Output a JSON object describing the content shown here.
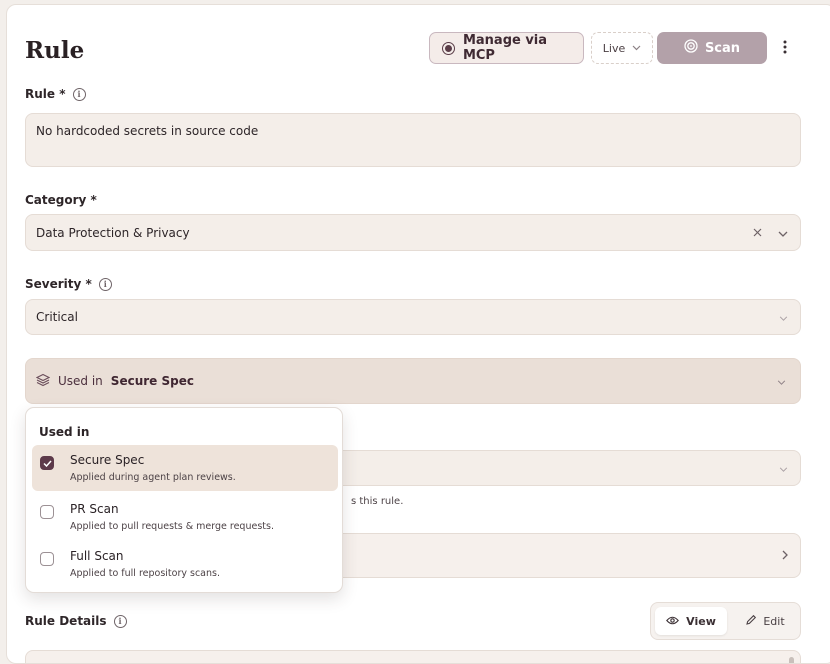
{
  "header": {
    "title": "Rule",
    "mcp_label": "Manage via MCP",
    "live_label": "Live",
    "scan_label": "Scan"
  },
  "rule": {
    "label": "Rule *",
    "value": "No hardcoded secrets in source code"
  },
  "category": {
    "label": "Category *",
    "value": "Data Protection & Privacy"
  },
  "severity": {
    "label": "Severity *",
    "value": "Critical"
  },
  "used_in_bar": {
    "prefix": "Used in",
    "value": "Secure Spec"
  },
  "helper_text": "s this rule.",
  "dropdown": {
    "heading": "Used in",
    "items": [
      {
        "title": "Secure Spec",
        "desc": "Applied during agent plan reviews.",
        "checked": true
      },
      {
        "title": "PR Scan",
        "desc": "Applied to pull requests & merge requests.",
        "checked": false
      },
      {
        "title": "Full Scan",
        "desc": "Applied to full repository scans.",
        "checked": false
      }
    ]
  },
  "details": {
    "label": "Rule Details",
    "view_label": "View",
    "edit_label": "Edit"
  },
  "colors": {
    "accent": "#5d3a4a",
    "scan_button": "#b3a1a9",
    "field_bg": "#f4eee9",
    "selected_bg": "#eee3da"
  },
  "icons": [
    "mcp-icon",
    "chevron-down-icon",
    "scan-icon",
    "more-vertical-icon",
    "info-icon",
    "clear-icon",
    "layers-icon",
    "chevron-right-icon",
    "check-icon",
    "eye-icon",
    "pencil-icon"
  ]
}
